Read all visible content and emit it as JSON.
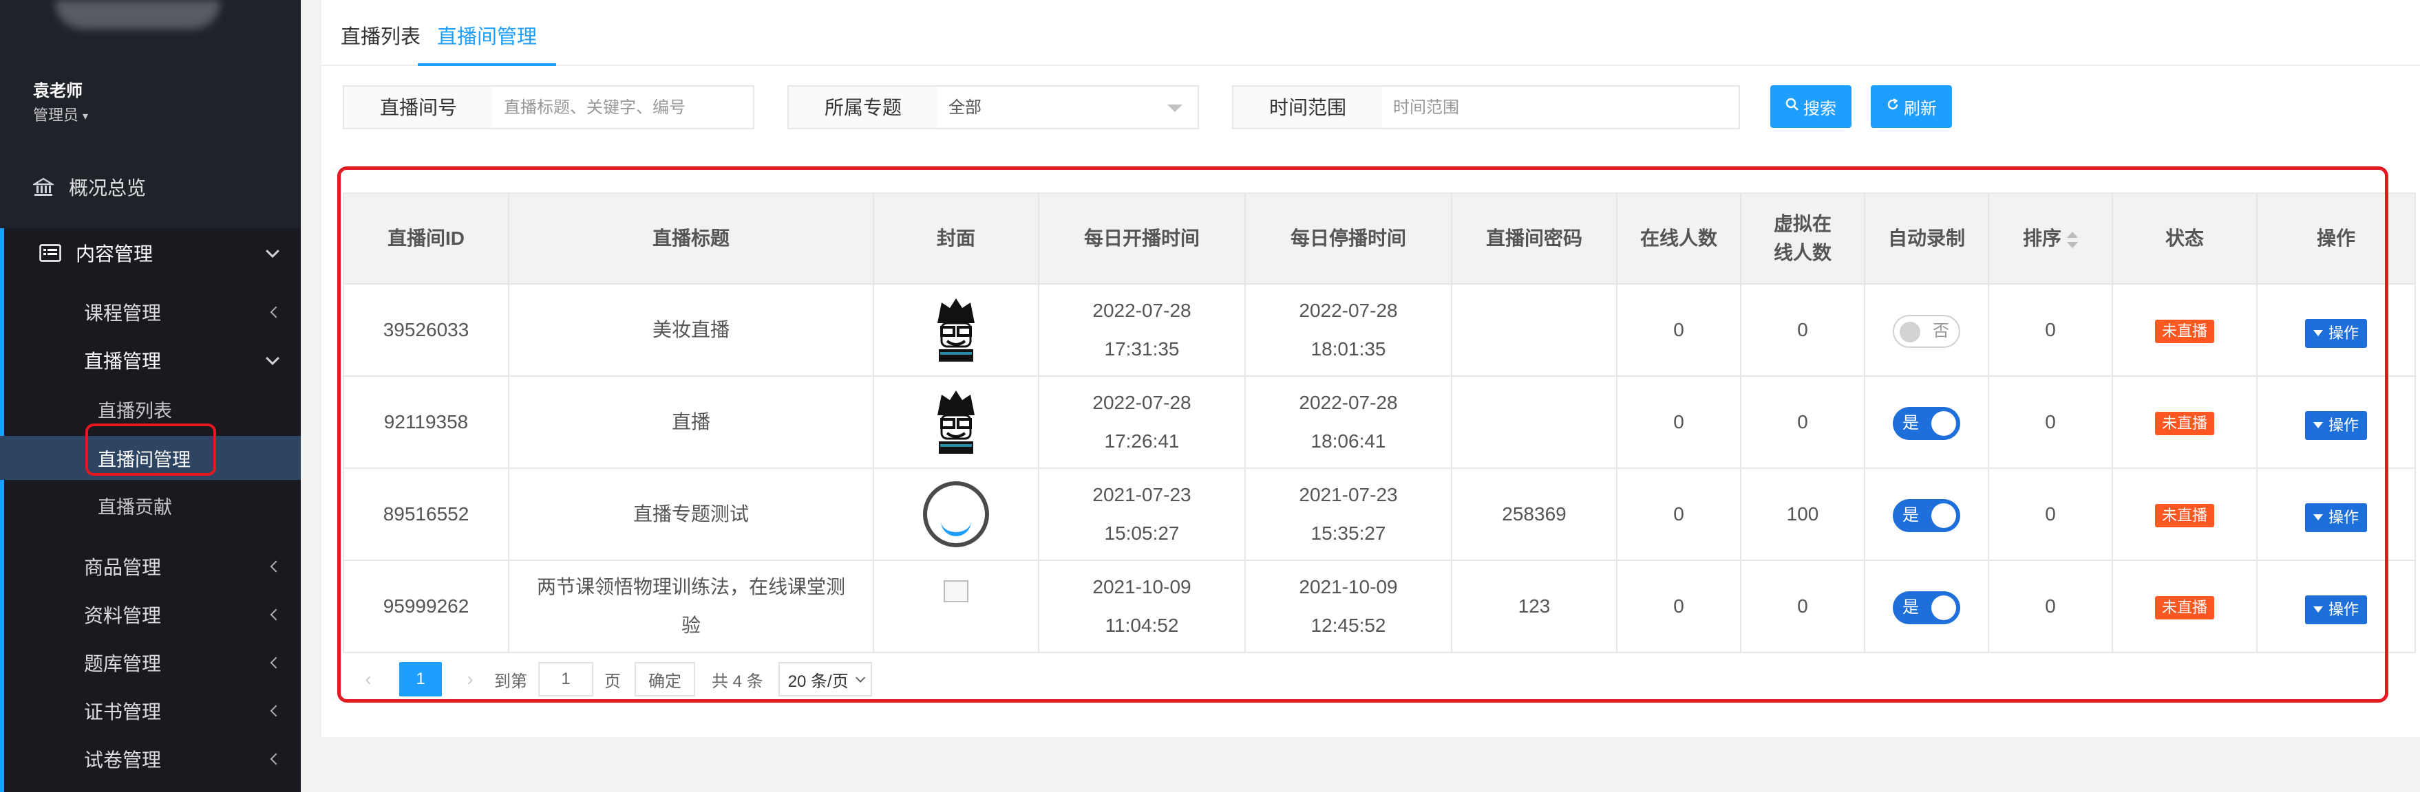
{
  "sidebar": {
    "user_name": "袁老师",
    "user_role": "管理员",
    "items": [
      {
        "label": "概况总览"
      },
      {
        "label": "内容管理"
      },
      {
        "label": "课程管理"
      },
      {
        "label": "直播管理"
      },
      {
        "label": "直播列表"
      },
      {
        "label": "直播间管理"
      },
      {
        "label": "直播贡献"
      },
      {
        "label": "商品管理"
      },
      {
        "label": "资料管理"
      },
      {
        "label": "题库管理"
      },
      {
        "label": "证书管理"
      },
      {
        "label": "试卷管理"
      }
    ]
  },
  "tabs": [
    {
      "label": "直播列表"
    },
    {
      "label": "直播间管理"
    }
  ],
  "filters": {
    "room_no": {
      "label": "直播间号",
      "placeholder": "直播标题、关键字、编号"
    },
    "topic": {
      "label": "所属专题",
      "value": "全部"
    },
    "time": {
      "label": "时间范围",
      "placeholder": "时间范围"
    },
    "search_btn": "搜索",
    "refresh_btn": "刷新"
  },
  "table": {
    "headers": [
      "直播间ID",
      "直播标题",
      "封面",
      "每日开播时间",
      "每日停播时间",
      "直播间密码",
      "在线人数",
      "虚拟在线人数",
      "自动录制",
      "排序",
      "状态",
      "操作"
    ],
    "rows": [
      {
        "id": "39526033",
        "title": "美妆直播",
        "start": "2022-07-28 17:31:35",
        "stop": "2022-07-28 18:01:35",
        "password": "",
        "online": "0",
        "virtual": "0",
        "auto_record": "否",
        "order": "0",
        "status": "未直播",
        "op": "操作"
      },
      {
        "id": "92119358",
        "title": "直播",
        "start": "2022-07-28 17:26:41",
        "stop": "2022-07-28 18:06:41",
        "password": "",
        "online": "0",
        "virtual": "0",
        "auto_record": "是",
        "order": "0",
        "status": "未直播",
        "op": "操作"
      },
      {
        "id": "89516552",
        "title": "直播专题测试",
        "start": "2021-07-23 15:05:27",
        "stop": "2021-07-23 15:35:27",
        "password": "258369",
        "online": "0",
        "virtual": "100",
        "auto_record": "是",
        "order": "0",
        "status": "未直播",
        "op": "操作"
      },
      {
        "id": "95999262",
        "title": "两节课领悟物理训练法，在线课堂测验",
        "start": "2021-10-09 11:04:52",
        "stop": "2021-10-09 12:45:52",
        "password": "123",
        "online": "0",
        "virtual": "0",
        "auto_record": "是",
        "order": "0",
        "status": "未直播",
        "op": "操作"
      }
    ]
  },
  "pagination": {
    "current": "1",
    "goto_label": "到第",
    "goto_value": "1",
    "page_label": "页",
    "confirm": "确定",
    "total": "共 4 条",
    "page_size": "20 条/页"
  },
  "colors": {
    "accent": "#1e9fff",
    "sidebar_bg": "#20222a",
    "status_badge": "#ff5722",
    "highlight_box": "#e5171f"
  }
}
